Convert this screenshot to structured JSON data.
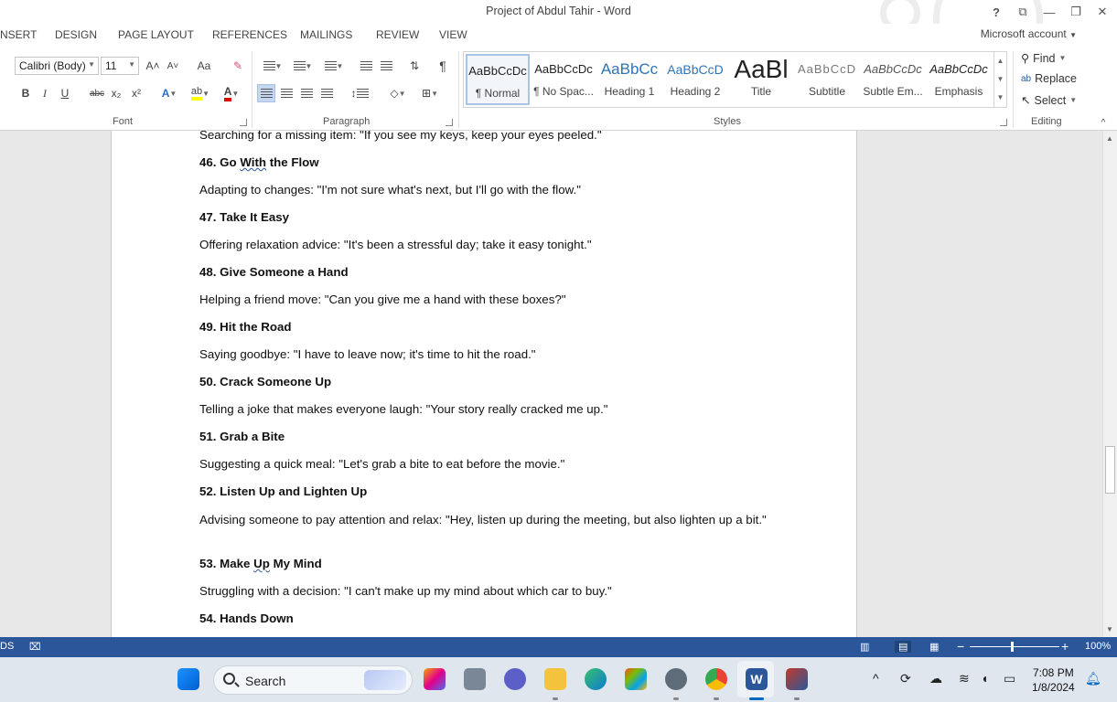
{
  "window": {
    "title": "Project of Abdul Tahir - Word",
    "help": "?",
    "ribbon_display": "⧉",
    "minimize": "—",
    "restore": "❐",
    "close": "✕"
  },
  "tabs": [
    "NSERT",
    "DESIGN",
    "PAGE LAYOUT",
    "REFERENCES",
    "MAILINGS",
    "REVIEW",
    "VIEW"
  ],
  "account": "Microsoft account",
  "font_group": {
    "label": "Font",
    "font_name": "Calibri (Body)",
    "font_size": "11",
    "grow": "A˄",
    "shrink": "A˅",
    "change_case": "Aa",
    "bold": "B",
    "italic": "I",
    "underline": "U",
    "strike": "abc",
    "subscript": "x₂",
    "superscript": "x²"
  },
  "paragraph_group": {
    "label": "Paragraph",
    "pilcrow": "¶"
  },
  "styles_group": {
    "label": "Styles",
    "items": [
      {
        "preview": "AaBbCcDc",
        "name": "¶ Normal"
      },
      {
        "preview": "AaBbCcDc",
        "name": "¶ No Spac..."
      },
      {
        "preview": "AaBbCc",
        "name": "Heading 1"
      },
      {
        "preview": "AaBbCcD",
        "name": "Heading 2"
      },
      {
        "preview": "AaBl",
        "name": "Title"
      },
      {
        "preview": "AaBbCcD",
        "name": "Subtitle"
      },
      {
        "preview": "AaBbCcDc",
        "name": "Subtle Em..."
      },
      {
        "preview": "AaBbCcDc",
        "name": "Emphasis"
      }
    ]
  },
  "editing_group": {
    "label": "Editing",
    "find": "Find",
    "replace": "Replace",
    "select": "Select"
  },
  "document": {
    "paragraphs": [
      {
        "type": "body",
        "text": "Searching for a missing item: \"If you see my keys, keep your eyes peeled.\""
      },
      {
        "type": "heading",
        "num": "46. Go ",
        "squiggle": "With",
        "rest": " the Flow"
      },
      {
        "type": "body",
        "text": "Adapting to changes: \"I'm not sure what's next, but I'll go with the flow.\""
      },
      {
        "type": "heading",
        "text": "47. Take It Easy"
      },
      {
        "type": "body",
        "text": "Offering relaxation advice: \"It's been a stressful day; take it easy tonight.\""
      },
      {
        "type": "heading",
        "text": "48. Give Someone a Hand"
      },
      {
        "type": "body",
        "text": "Helping a friend move: \"Can you give me a hand with these boxes?\""
      },
      {
        "type": "heading",
        "text": "49. Hit the Road"
      },
      {
        "type": "body",
        "text": "Saying goodbye: \"I have to leave now; it's time to hit the road.\""
      },
      {
        "type": "heading",
        "text": "50. Crack Someone Up"
      },
      {
        "type": "body",
        "text": "Telling a joke that makes everyone laugh: \"Your story really cracked me up.\""
      },
      {
        "type": "heading",
        "text": "51. Grab a Bite"
      },
      {
        "type": "body",
        "text": "Suggesting a quick meal: \"Let's grab a bite to eat before the movie.\""
      },
      {
        "type": "heading",
        "text": "52. Listen Up and Lighten Up"
      },
      {
        "type": "body",
        "text": "Advising someone to pay attention and relax: \"Hey, listen up during the meeting, but also lighten up a bit.\""
      },
      {
        "type": "heading",
        "num": "53. Make ",
        "squiggle": "Up",
        "rest": " My Mind"
      },
      {
        "type": "body",
        "text": "Struggling with a decision: \"I can't make up my mind about which car to buy.\""
      },
      {
        "type": "heading",
        "text": "54. Hands Down"
      }
    ]
  },
  "statusbar": {
    "left_text": "DS",
    "zoom": "100%"
  },
  "taskbar": {
    "search_label": "Search",
    "time": "7:08 PM",
    "date": "1/8/2024"
  },
  "colors": {
    "status_blue": "#2b579a",
    "taskbar_bg": "#dfe6ee",
    "font_color_red": "#e00000",
    "highlight_yellow": "#ffff00"
  }
}
